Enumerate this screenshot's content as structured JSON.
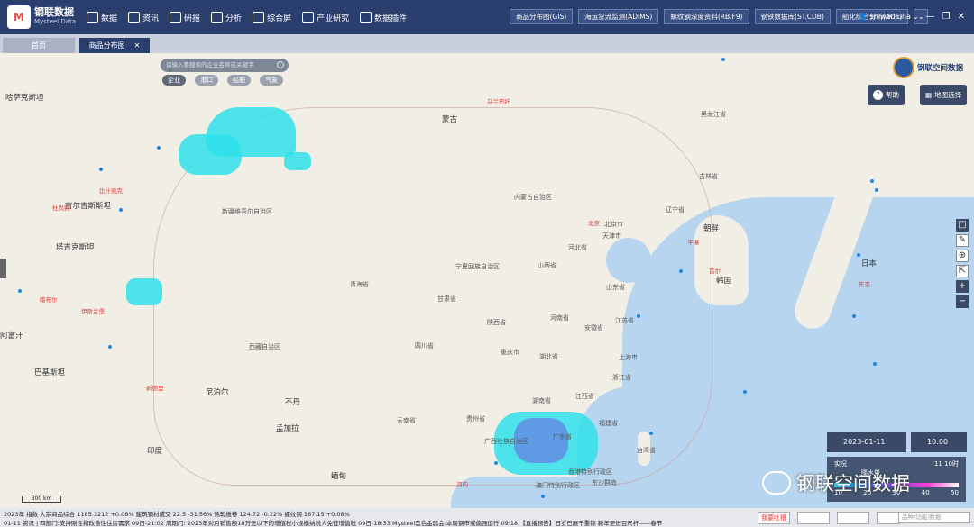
{
  "app": {
    "logo_cn": "钢联数据",
    "logo_en": "Mysteel Data"
  },
  "nav": [
    {
      "label": "数据"
    },
    {
      "label": "资讯"
    },
    {
      "label": "研报"
    },
    {
      "label": "分析"
    },
    {
      "label": "综合屏"
    },
    {
      "label": "产业研究"
    },
    {
      "label": "数据插件"
    }
  ],
  "systems": [
    {
      "label": "商品分布图(GIS)"
    },
    {
      "label": "海运货流监测(ADIMS)"
    },
    {
      "label": "螺纹钢深度资料(RB.F9)"
    },
    {
      "label": "钢铁数据库(ST.CDB)"
    },
    {
      "label": "船化综合分析(AOE)"
    }
  ],
  "user": {
    "name": "shiwenjuna"
  },
  "tabs": {
    "home": "首页",
    "active": "商品分布图"
  },
  "search": {
    "placeholder": "请输入要搜索的企业名称或关键字"
  },
  "filters": [
    {
      "label": "企业"
    },
    {
      "label": "港口"
    },
    {
      "label": "船舶"
    },
    {
      "label": "气象"
    }
  ],
  "brand": "钢联空间数据",
  "help_label": "帮助",
  "layer_label": "地图选择",
  "map_labels": {
    "countries": [
      "哈萨克斯坦",
      "蒙古",
      "朝鲜",
      "日本",
      "韩国",
      "吉尔吉斯斯坦",
      "塔吉克斯坦",
      "尼泊尔",
      "不丹",
      "孟加拉",
      "缅甸",
      "印度",
      "巴基斯坦",
      "阿富汗"
    ],
    "provinces": [
      "内蒙古自治区",
      "新疆维吾尔自治区",
      "西藏自治区",
      "青海省",
      "甘肃省",
      "宁夏回族自治区",
      "四川省",
      "陕西省",
      "山西省",
      "河北省",
      "北京市",
      "天津市",
      "山东省",
      "河南省",
      "江苏省",
      "安徽省",
      "上海市",
      "湖北省",
      "重庆市",
      "浙江省",
      "湖南省",
      "江西省",
      "贵州省",
      "福建省",
      "广西壮族自治区",
      "广东省",
      "台湾省",
      "辽宁省",
      "吉林省",
      "黑龙江省",
      "云南省",
      "澳门特别行政区",
      "香港特别行政区",
      "东沙群岛"
    ],
    "cities": [
      "乌兰巴托",
      "比什凯克",
      "伊斯兰堡",
      "新德里",
      "北京",
      "平壤",
      "首尔",
      "东京",
      "杜尚别",
      "喀布尔",
      "河内"
    ]
  },
  "scale_label": "300 km",
  "date": "2023-01-11",
  "time": "10:00",
  "legend": {
    "title": "实况",
    "sub": "降水量",
    "ticks": [
      "10",
      "20",
      "30",
      "40",
      "50"
    ],
    "range": "11 10时"
  },
  "watermark": "钢联空间数据",
  "ticker": {
    "row1": "2023年 指数 大宗商品综合 1185.3212 +0.08% 建筑钢材成交 22.5 -31.56% 热轧板卷 124.72 -0.22% 螺纹钢 167.15 +0.08%",
    "row2": "01-11 资讯 | 四部门:支持刚性和改善性住房需求 09日-21:02 周期门: 2023年对月销售额10万元以下的增值税小规模纳税人免征增值税 09日-18:33 Mysteel黑色金属会:本周钢市或偏强运行 09:18 【直播预告】旧岁已展千重锦 新年更进百尺杆——春节"
  },
  "bottom_btns": [
    {
      "label": "我要吐槽"
    },
    {
      "label": "我要服务"
    },
    {
      "label": "新手引导"
    },
    {
      "label": "1.8.3"
    }
  ],
  "bottom_search": "品种/功能/数据"
}
